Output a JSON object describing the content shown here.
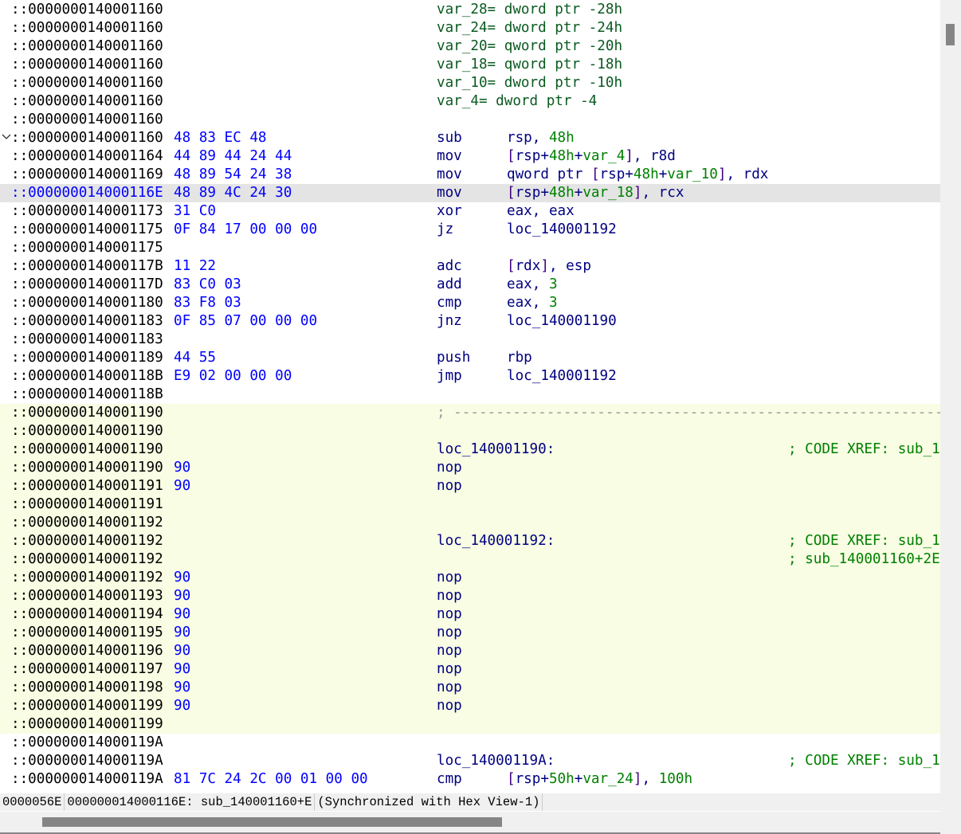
{
  "listing": [
    {
      "addr": "::0000000140001160",
      "bytes": "",
      "mn": "",
      "ops": "",
      "label": "var_28= dword ptr -28h"
    },
    {
      "addr": "::0000000140001160",
      "bytes": "",
      "mn": "",
      "ops": "",
      "label": "var_24= dword ptr -24h"
    },
    {
      "addr": "::0000000140001160",
      "bytes": "",
      "mn": "",
      "ops": "",
      "label": "var_20= qword ptr -20h"
    },
    {
      "addr": "::0000000140001160",
      "bytes": "",
      "mn": "",
      "ops": "",
      "label": "var_18= qword ptr -18h"
    },
    {
      "addr": "::0000000140001160",
      "bytes": "",
      "mn": "",
      "ops": "",
      "label": "var_10= dword ptr -10h"
    },
    {
      "addr": "::0000000140001160",
      "bytes": "",
      "mn": "",
      "ops": "",
      "label": "var_4= dword ptr -4"
    },
    {
      "addr": "::0000000140001160"
    },
    {
      "addr": "::0000000140001160",
      "bytes": "48 83 EC 48",
      "mn": "sub",
      "ops": "rsp, 48h",
      "fold": true
    },
    {
      "addr": "::0000000140001164",
      "bytes": "44 89 44 24 44",
      "mn": "mov",
      "ops": "[rsp+48h+var_4], r8d"
    },
    {
      "addr": "::0000000140001169",
      "bytes": "48 89 54 24 38",
      "mn": "mov",
      "ops": "qword ptr [rsp+48h+var_10], rdx"
    },
    {
      "addr": "::000000014000116E",
      "bytes": "48 89 4C 24 30",
      "mn": "mov",
      "ops": "[rsp+48h+var_18], rcx",
      "current": true
    },
    {
      "addr": "::0000000140001173",
      "bytes": "31 C0",
      "mn": "xor",
      "ops": "eax, eax"
    },
    {
      "addr": "::0000000140001175",
      "bytes": "0F 84 17 00 00 00",
      "mn": "jz",
      "ops": "loc_140001192"
    },
    {
      "addr": "::0000000140001175"
    },
    {
      "addr": "::000000014000117B",
      "bytes": "11 22",
      "mn": "adc",
      "ops": "[rdx], esp"
    },
    {
      "addr": "::000000014000117D",
      "bytes": "83 C0 03",
      "mn": "add",
      "ops": "eax, 3"
    },
    {
      "addr": "::0000000140001180",
      "bytes": "83 F8 03",
      "mn": "cmp",
      "ops": "eax, 3"
    },
    {
      "addr": "::0000000140001183",
      "bytes": "0F 85 07 00 00 00",
      "mn": "jnz",
      "ops": "loc_140001190"
    },
    {
      "addr": "::0000000140001183"
    },
    {
      "addr": "::0000000140001189",
      "bytes": "44 55",
      "mn": "push",
      "ops": "rbp"
    },
    {
      "addr": "::000000014000118B",
      "bytes": "E9 02 00 00 00",
      "mn": "jmp",
      "ops": "loc_140001192"
    },
    {
      "addr": "::000000014000118B"
    },
    {
      "addr": "::0000000140001190",
      "dash": "; -----------------------------------------------------------------",
      "yellow": true
    },
    {
      "addr": "::0000000140001190",
      "yellow": true
    },
    {
      "addr": "::0000000140001190",
      "label": "loc_140001190:",
      "comment": "; CODE XREF: sub_1",
      "yellow": true
    },
    {
      "addr": "::0000000140001190",
      "bytes": "90",
      "mn": "nop",
      "yellow": true
    },
    {
      "addr": "::0000000140001191",
      "bytes": "90",
      "mn": "nop",
      "yellow": true
    },
    {
      "addr": "::0000000140001191",
      "yellow": true
    },
    {
      "addr": "::0000000140001192",
      "yellow": true
    },
    {
      "addr": "::0000000140001192",
      "label": "loc_140001192:",
      "comment": "; CODE XREF: sub_1",
      "yellow": true
    },
    {
      "addr": "::0000000140001192",
      "comment": "; sub_140001160+2E",
      "yellow": true
    },
    {
      "addr": "::0000000140001192",
      "bytes": "90",
      "mn": "nop",
      "yellow": true
    },
    {
      "addr": "::0000000140001193",
      "bytes": "90",
      "mn": "nop",
      "yellow": true
    },
    {
      "addr": "::0000000140001194",
      "bytes": "90",
      "mn": "nop",
      "yellow": true
    },
    {
      "addr": "::0000000140001195",
      "bytes": "90",
      "mn": "nop",
      "yellow": true
    },
    {
      "addr": "::0000000140001196",
      "bytes": "90",
      "mn": "nop",
      "yellow": true
    },
    {
      "addr": "::0000000140001197",
      "bytes": "90",
      "mn": "nop",
      "yellow": true
    },
    {
      "addr": "::0000000140001198",
      "bytes": "90",
      "mn": "nop",
      "yellow": true
    },
    {
      "addr": "::0000000140001199",
      "bytes": "90",
      "mn": "nop",
      "yellow": true
    },
    {
      "addr": "::0000000140001199",
      "yellow": true
    },
    {
      "addr": "::000000014000119A"
    },
    {
      "addr": "::000000014000119A",
      "label": "loc_14000119A:",
      "comment": "; CODE XREF: sub_1"
    },
    {
      "addr": "::000000014000119A",
      "bytes": "81 7C 24 2C 00 01 00 00",
      "mn": "cmp",
      "ops": "[rsp+50h+var_24], 100h"
    }
  ],
  "status": {
    "offset": "0000056E",
    "location": "000000014000116E: sub_140001160+E",
    "sync": "(Synchronized with Hex View-1)"
  },
  "colors": {
    "address": "#000000",
    "bytes": "#0000ff",
    "mnemonic": "#000080",
    "number": "#008000",
    "comment": "#008000",
    "current_line": "#e4e4e4",
    "function_block": "#f8fde3"
  }
}
